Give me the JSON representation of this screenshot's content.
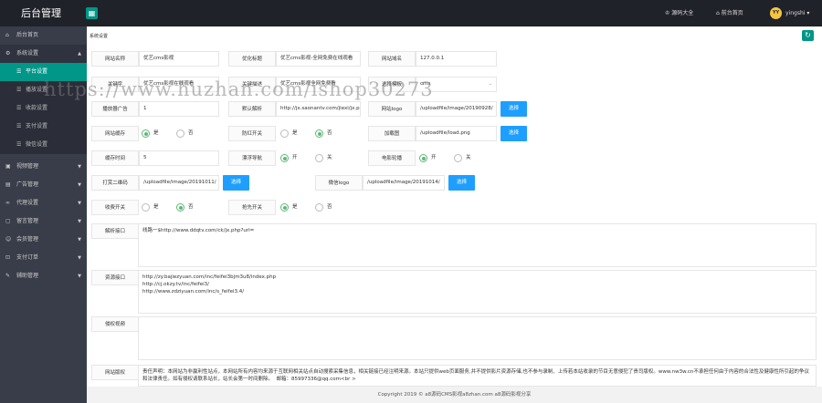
{
  "topbar": {
    "brand": "后台管理",
    "menu_icon": "grid-icon",
    "source_link": "源码大全",
    "home_link": "前台首页",
    "avatar_text": "YY",
    "username": "yingshi"
  },
  "sidebar": {
    "home": "后台首页",
    "system": "系统设置",
    "subs": [
      "平台设置",
      "播放设置",
      "收款设置",
      "支付设置",
      "微信设置"
    ],
    "groups": [
      "视频管理",
      "广告管理",
      "代理设置",
      "留言管理",
      "会员管理",
      "支付订单",
      "辅助管理"
    ]
  },
  "page": {
    "breadcrumb": "系统设置",
    "refresh_icon": "refresh-icon"
  },
  "form": {
    "site_name_label": "网站名称",
    "site_name": "优艺cms影视",
    "seo_title_label": "优化标题",
    "seo_title": "优艺cms影视-全网免费在线观看",
    "domain_label": "网站域名",
    "domain": "127.0.0.1",
    "keywords_label": "关键字",
    "keywords": "优艺cms影视在线观看",
    "desc_label": "关键描述",
    "desc": "优艺cms影视全网免费看",
    "template_label": "选择模板",
    "template": "cms",
    "player_ad_label": "播放器广告",
    "player_ad": "1",
    "parse_label": "默认解析",
    "parse": "http://jx.saonantv.com/jiexi/jx.php?url=",
    "logo_label": "网站logo",
    "logo": "/uploadfile/image/20190928/",
    "cache_label": "网站缓存",
    "anti_label": "防红开关",
    "loading_label": "加载图",
    "loading": "/uploadfile/load.png",
    "cache_time_label": "缓存时间",
    "cache_time": "5",
    "float_label": "漂浮导航",
    "carousel_label": "电影轮播",
    "qr_label": "打赏二维码",
    "qr": "/uploadfile/image/20191011/",
    "wechat_logo_label": "微信logo",
    "wechat_logo": "/uploadfile/image/20191014/",
    "collect_label": "收费开关",
    "snatch_label": "抢先开关",
    "yes": "是",
    "no": "否",
    "on": "开",
    "off": "关",
    "choose": "选择",
    "api_label": "解析接口",
    "api": "线路一$http://www.ddqtv.com/ck/jx.php?url=",
    "source_label": "资源接口",
    "source": "http://zy.bajiezyuan.com/inc/feifei3bjm3u8/index.php\nhttp://cj.okzy.tv/inc/feifei3/\nhttp://www.zdziyuan.com/inc/s_feifei3.4/",
    "copyright_label": "侵权视频",
    "disclaimer_label": "网站版权",
    "disclaimer": "责任声明：本网站为非赢利性站点，本网站所有内容均来源于互联网相关站点自动搜索采集信息，相关链接已经注明来源。本站只提供web页面服务,并不提供影片资源存储,也不参与录制、上传若本站收录的节目无意侵犯了贵司版权。www.nw3w.cn不承担任何由于内容的合法性及健康性所引起的争议和法律责任。如有侵权请联系站长，站长会第一时间删除。  邮箱：85997336@qq.com<br >"
  },
  "footer": {
    "text": "Copyright 2019 © a8源码CMS影视a8zhan.com a8源码影视分享"
  },
  "watermark": "https://www.huzhan.com/ishop30273"
}
